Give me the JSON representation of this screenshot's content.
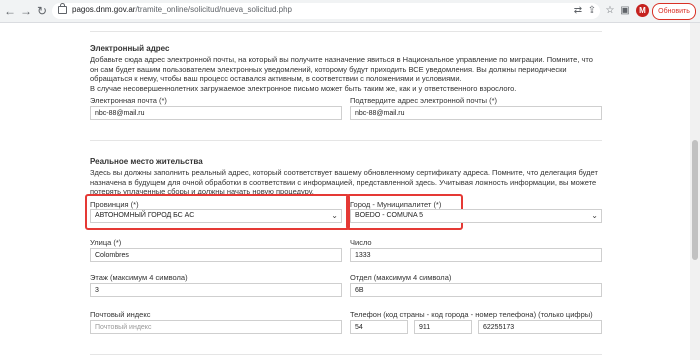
{
  "browser": {
    "url_domain": "pagos.dnm.gov.ar",
    "url_path": "/tramite_online/solicitud/nueva_solicitud.php",
    "avatar_letter": "M",
    "update_label": "Обновить"
  },
  "email_section": {
    "title": "Электронный адрес",
    "paragraph": "Добавьте сюда адрес электронной почты, на который вы получите назначение явиться в Национальное управление по миграции. Помните, что он сам будет вашим пользователем электронных уведомлений, которому будут приходить ВСЕ уведомления. Вы должны периодически обращаться к нему, чтобы ваш процесс оставался активным, в соответствии с положениями и условиями.",
    "note": "В случае несовершеннолетних загружаемое электронное письмо может быть таким же, как и у ответственного взрослого.",
    "email_label": "Электронная почта (*)",
    "email_value": "nbc-88@mail.ru",
    "confirm_label": "Подтвердите адрес электронной почты (*)",
    "confirm_value": "nbc-88@mail.ru"
  },
  "residence_section": {
    "title": "Реальное место жительства",
    "paragraph": "Здесь вы должны заполнить реальный адрес, который соответствует вашему обновленному сертификату адреса. Помните, что делегация будет назначена в будущем для очной обработки в соответствии с информацией, представленной здесь. Учитывая ложность информации, вы можете потерять уплаченные сборы и должны начать новую процедуру.",
    "province_label": "Провинция (*)",
    "province_value": "АВТОНОМНЫЙ ГОРОД БС АС",
    "city_label": "Город - Муниципалитет (*)",
    "city_value": "BOEDO - COMUNA 5",
    "street_label": "Улица (*)",
    "street_value": "Colombres",
    "number_label": "Число",
    "number_value": "1333",
    "floor_label": "Этаж (максимум 4 символа)",
    "floor_value": "3",
    "dept_label": "Отдел (максимум 4 символа)",
    "dept_value": "6B",
    "postal_label": "Почтовый индекс",
    "postal_placeholder": "Почтовый индекс",
    "phone_label": "Телефон (код страны - код города - номер телефона) (только цифры)",
    "phone_country": "54",
    "phone_area": "911",
    "phone_number": "62255173"
  },
  "colors": {
    "highlight": "#e53935",
    "update": "#d93025"
  }
}
